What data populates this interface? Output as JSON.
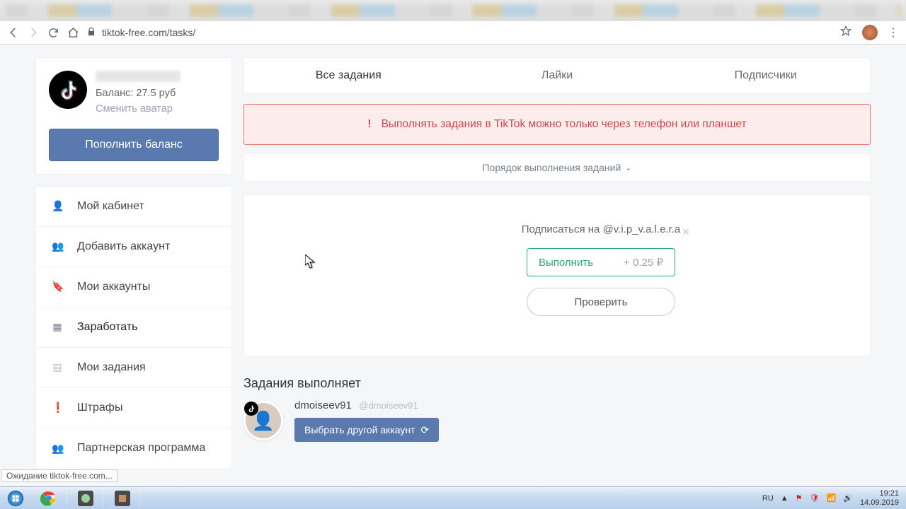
{
  "browser": {
    "url": "tiktok-free.com/tasks/"
  },
  "profile": {
    "balance_label": "Баланс: 27.5 руб",
    "change_avatar": "Сменить аватар",
    "topup": "Пополнить баланс"
  },
  "menu": {
    "items": [
      {
        "label": "Мой кабинет",
        "icon": "👤"
      },
      {
        "label": "Добавить аккаунт",
        "icon": "👥"
      },
      {
        "label": "Мои аккаунты",
        "icon": "🔖"
      },
      {
        "label": "Заработать",
        "icon": "▦",
        "active": true
      },
      {
        "label": "Мои задания",
        "icon": "▤"
      },
      {
        "label": "Штрафы",
        "icon": "❗"
      },
      {
        "label": "Партнерская программа",
        "icon": "👥"
      }
    ]
  },
  "tabs": {
    "all": "Все задания",
    "likes": "Лайки",
    "subs": "Подписчики"
  },
  "alert": {
    "text": "Выполнять задания в TikTok можно только через телефон или планшет"
  },
  "order_bar": "Порядок выполнения заданий",
  "task": {
    "title": "Подписаться на @v.i.p_v.a.l.e.r.a",
    "exec": "Выполнить",
    "price": "+ 0.25 ₽",
    "check": "Проверить"
  },
  "section_title": "Задания выполняет",
  "executor": {
    "name": "dmoiseev91",
    "handle": "@dmoiseev91",
    "switch": "Выбрать другой аккаунт"
  },
  "status": "Ожидание tiktok-free.com...",
  "taskbar": {
    "lang": "RU",
    "time": "19:21",
    "date": "14.09.2019"
  }
}
